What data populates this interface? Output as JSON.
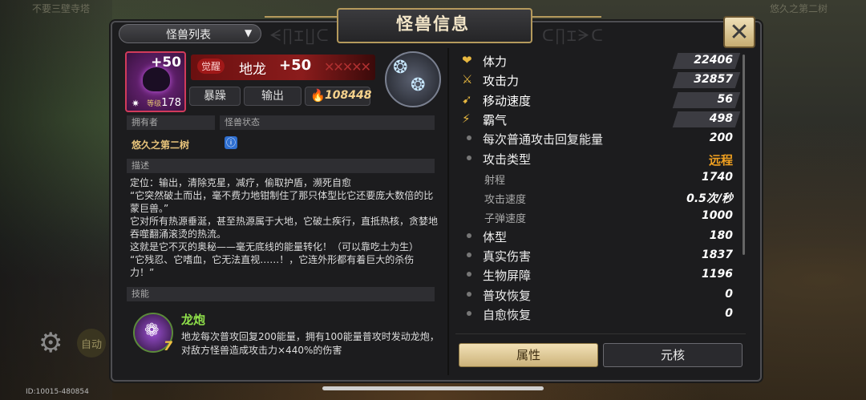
{
  "window": {
    "title": "怪兽信息",
    "id_text": "ID:10015-480854"
  },
  "background": {
    "top_left_text": "不要三壁寺塔",
    "top_right_text": "悠久之第二树",
    "auto_label": "自动"
  },
  "dropdown": {
    "label": "怪兽列表"
  },
  "monster": {
    "awaken_badge": "觉醒",
    "name": "地龙",
    "plus": "+50",
    "portrait_plus": "+50",
    "level_label": "等级",
    "level": "178",
    "trait_1": "暴躁",
    "role": "输出",
    "power": "108448"
  },
  "owner_section": {
    "owner_header": "拥有者",
    "status_header": "怪兽状态",
    "owner_name": "悠久之第二树",
    "status_icon_text": "ⓘ"
  },
  "description": {
    "header": "描述",
    "lines": [
      "定位：输出，清除克星，减疗，偷取护盾，濒死自愈",
      "“它突然破土而出，毫不费力地钳制住了那只体型比它还要庞大数倍的比蒙巨兽。”",
      "它对所有热源垂涎，甚至热源属于大地，它破土疾行，直抵热核，贪婪地吞噬翻涌滚烫的热流。",
      "这就是它不灭的奥秘——毫无底线的能量转化！（可以靠吃土为生）",
      "“它残忍、它嗜血，它无法直视……！，它连外形都有着巨大的杀伤力！”"
    ]
  },
  "skill": {
    "header": "技能",
    "name": "龙炮",
    "level": "7",
    "desc": "地龙每次普攻回复200能量，拥有100能量普攻时发动龙炮，对敌方怪兽造成攻击力×440%的伤害"
  },
  "stats": [
    {
      "label": "体力",
      "value": "22406",
      "kind": "main",
      "icon": "heart-icon"
    },
    {
      "label": "攻击力",
      "value": "32857",
      "kind": "main",
      "icon": "sword-icon"
    },
    {
      "label": "移动速度",
      "value": "56",
      "kind": "main",
      "icon": "wing-icon"
    },
    {
      "label": "霸气",
      "value": "498",
      "kind": "main",
      "icon": "claw-icon"
    },
    {
      "label": "每次普通攻击回复能量",
      "value": "200",
      "kind": "dot"
    },
    {
      "label": "攻击类型",
      "value": "远程",
      "kind": "dot-orange"
    },
    {
      "label": "射程",
      "value": "1740",
      "kind": "sub"
    },
    {
      "label": "攻击速度",
      "value": "0.5次/秒",
      "kind": "sub"
    },
    {
      "label": "子弹速度",
      "value": "1000",
      "kind": "sub"
    },
    {
      "label": "体型",
      "value": "180",
      "kind": "dot"
    },
    {
      "label": "真实伤害",
      "value": "1837",
      "kind": "dot"
    },
    {
      "label": "生物屏障",
      "value": "1196",
      "kind": "dot"
    },
    {
      "label": "普攻恢复",
      "value": "0",
      "kind": "dot"
    },
    {
      "label": "自愈恢复",
      "value": "0",
      "kind": "dot"
    }
  ],
  "tabs": {
    "attributes": "属性",
    "core": "元核"
  }
}
